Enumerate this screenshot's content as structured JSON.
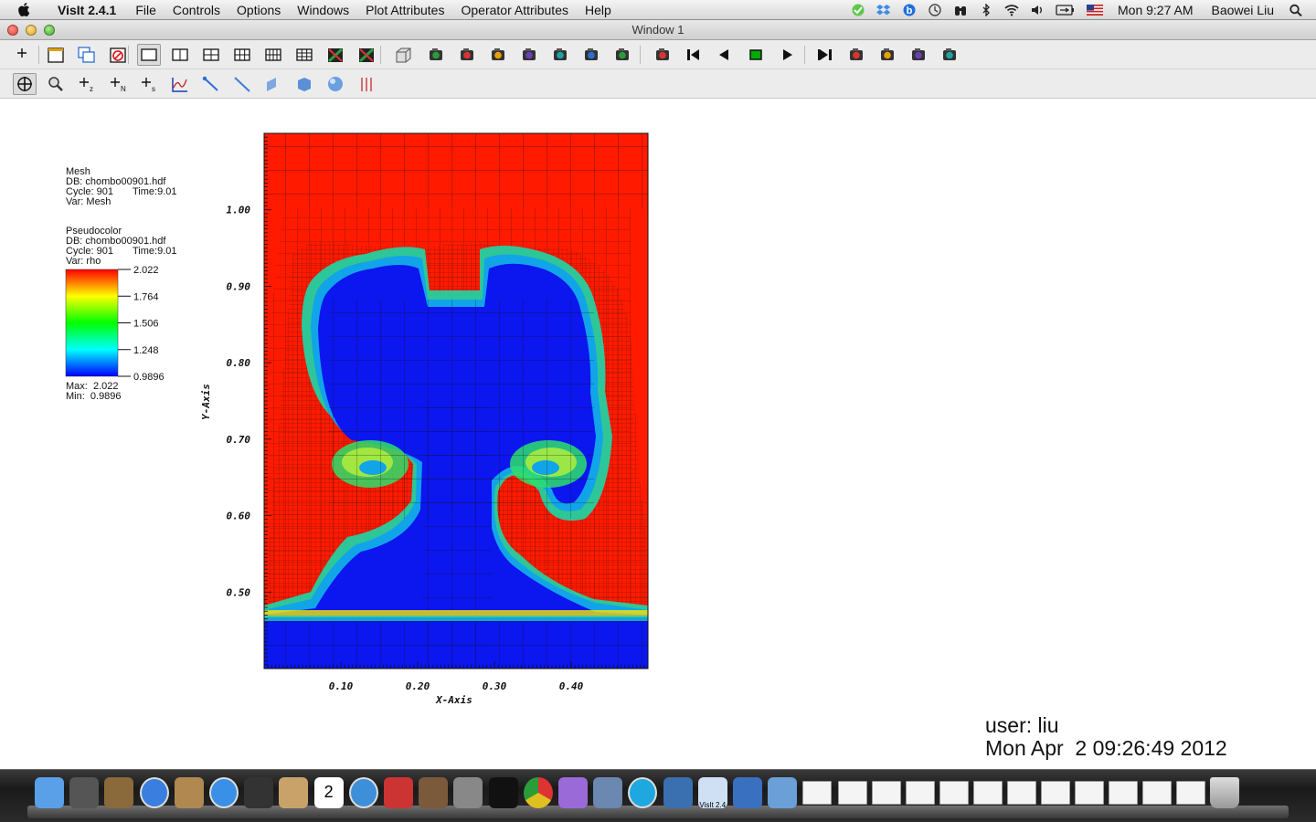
{
  "menubar": {
    "app_name": "VisIt 2.4.1",
    "menus": [
      "File",
      "Controls",
      "Options",
      "Windows",
      "Plot Attributes",
      "Operator Attributes",
      "Help"
    ],
    "clock": "Mon 9:27 AM",
    "user": "Baowei Liu",
    "status_icons": [
      "messages-icon",
      "dropbox-icon",
      "bluetooth-b-icon",
      "time-machine-icon",
      "binoculars-icon",
      "bluetooth-icon",
      "wifi-icon",
      "volume-icon",
      "battery-icon",
      "us-flag-icon",
      "spotlight-search-icon"
    ]
  },
  "window": {
    "title": "Window 1"
  },
  "toolbar1": {
    "buttons": [
      "clear-pick-icon",
      "new-window-icon",
      "clone-window-icon",
      "delete-window-icon",
      "layout-1x1-icon",
      "layout-1x2-icon",
      "layout-2x2-icon",
      "layout-2x3-icon",
      "layout-2x4-icon",
      "layout-3x3-icon",
      "lock-view-icon",
      "lock-time-icon",
      "perspective-icon",
      "draw-plots-icon",
      "clear-plots-icon",
      "save-image-icon",
      "copy-image-icon",
      "undo-view-icon",
      "redo-view-icon",
      "camera-icon",
      "spin-icon",
      "reverse-step-icon",
      "reverse-play-icon",
      "stop-icon",
      "play-icon",
      "forward-step-icon",
      "annotations-icon",
      "lighting-icon",
      "pick-lighting-icon",
      "output-icon"
    ]
  },
  "toolbar2": {
    "buttons": [
      "navigate-icon",
      "zoom-icon",
      "zone-pick-icon",
      "node-pick-icon",
      "spreadsheet-pick-icon",
      "curve-pick-icon",
      "line-out-icon",
      "line-tool-icon",
      "plane-tool-icon",
      "box-tool-icon",
      "sphere-tool-icon",
      "axis-restrict-icon"
    ]
  },
  "legend": {
    "mesh": {
      "title": "Mesh",
      "db": "DB: chombo00901.hdf",
      "cycle": "Cycle: 901",
      "time": "Time:9.01",
      "var": "Var: Mesh"
    },
    "pseudocolor": {
      "title": "Pseudocolor",
      "db": "DB: chombo00901.hdf",
      "cycle": "Cycle: 901",
      "time": "Time:9.01",
      "var": "Var: rho",
      "ticks": [
        "2.022",
        "1.764",
        "1.506",
        "1.248",
        "0.9896"
      ],
      "max": "Max:  2.022",
      "min": "Min:  0.9896",
      "colormap": [
        "#ff0000",
        "#ffff00",
        "#00ff00",
        "#00ffff",
        "#0000ff"
      ]
    }
  },
  "plot": {
    "x_axis_title": "X-Axis",
    "y_axis_title": "Y-Axis",
    "x_ticks": [
      "0.10",
      "0.20",
      "0.30",
      "0.40"
    ],
    "y_ticks": [
      "1.00",
      "0.90",
      "0.80",
      "0.70",
      "0.60",
      "0.50"
    ],
    "x_range": [
      0.0,
      0.5
    ],
    "y_range": [
      0.4,
      1.1
    ],
    "background_color": "#ff1a00",
    "bubble_color": "#0c16ee"
  },
  "user_info": {
    "user": "user: liu",
    "date": "Mon Apr  2 09:26:49 2012"
  },
  "dock": {
    "items": [
      "finder-icon",
      "launchpad-icon",
      "system-profiler-icon",
      "app-store-icon",
      "preview-icon",
      "safari-icon",
      "facetime-icon",
      "contacts-icon",
      "calendar-icon",
      "itunes-icon",
      "photo-booth-icon",
      "iphoto-icon",
      "system-preferences-icon",
      "terminal-icon",
      "chrome-icon",
      "emacs-icon",
      "image-capture-icon",
      "skype-icon",
      "wordpress-icon",
      "visit-icon",
      "xcode-icon",
      "folder-icon",
      "document-icon",
      "window-thumbnail-icon",
      "window-thumbnail-icon",
      "window-thumbnail-icon",
      "window-thumbnail-icon",
      "window-thumbnail-icon",
      "window-thumbnail-icon",
      "window-thumbnail-icon",
      "window-thumbnail-icon",
      "window-thumbnail-icon",
      "window-thumbnail-icon",
      "window-thumbnail-icon",
      "trash-icon"
    ],
    "visit_label": "VisIt 2.4",
    "calendar_day": "2"
  }
}
